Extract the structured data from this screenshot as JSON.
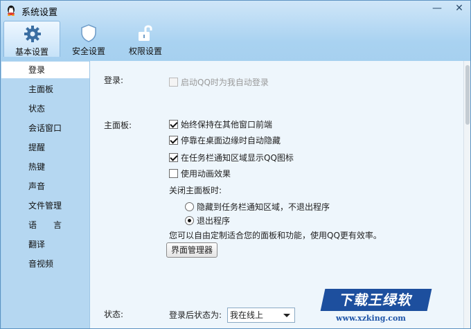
{
  "window": {
    "title": "系统设置",
    "app_icon": "qq-penguin-icon"
  },
  "window_controls": {
    "minimize": "—",
    "close": "✕"
  },
  "tabs": [
    {
      "label": "基本设置",
      "icon": "gear-icon",
      "active": true
    },
    {
      "label": "安全设置",
      "icon": "shield-icon",
      "active": false
    },
    {
      "label": "权限设置",
      "icon": "unlock-icon",
      "active": false
    }
  ],
  "sidebar": {
    "items": [
      {
        "label": "登录",
        "active": true
      },
      {
        "label": "主面板"
      },
      {
        "label": "状态"
      },
      {
        "label": "会话窗口"
      },
      {
        "label": "提醒"
      },
      {
        "label": "热键"
      },
      {
        "label": "声音"
      },
      {
        "label": "文件管理"
      },
      {
        "label": "语　　言"
      },
      {
        "label": "翻译"
      },
      {
        "label": "音视频"
      }
    ]
  },
  "login": {
    "section_label": "登录:",
    "auto_login": {
      "label": "启动QQ时为我自动登录",
      "checked": false,
      "disabled": true
    }
  },
  "main_panel": {
    "section_label": "主面板:",
    "always_on_top": {
      "label": "始终保持在其他窗口前端",
      "checked": true
    },
    "auto_hide": {
      "label": "停靠在桌面边缘时自动隐藏",
      "checked": true
    },
    "tray_icon": {
      "label": "在任务栏通知区域显示QQ图标",
      "checked": true
    },
    "animation": {
      "label": "使用动画效果",
      "checked": false
    },
    "close_label": "关闭主面板时:",
    "close_hide": {
      "label": "隐藏到任务栏通知区域，不退出程序",
      "selected": false
    },
    "close_exit": {
      "label": "退出程序",
      "selected": true
    },
    "hint": "您可以自由定制适合您的面板和功能，使用QQ更有效率。",
    "manager_button": "界面管理器"
  },
  "status": {
    "section_label": "状态:",
    "after_login_label": "登录后状态为:",
    "after_login_value": "我在线上"
  },
  "watermark": {
    "title": "下载王绿软",
    "url": "www.xzking.com"
  },
  "colors": {
    "accent": "#1d4f9e",
    "sidebar_bg": "#b5d7f1",
    "content_bg": "#eef6fc"
  }
}
